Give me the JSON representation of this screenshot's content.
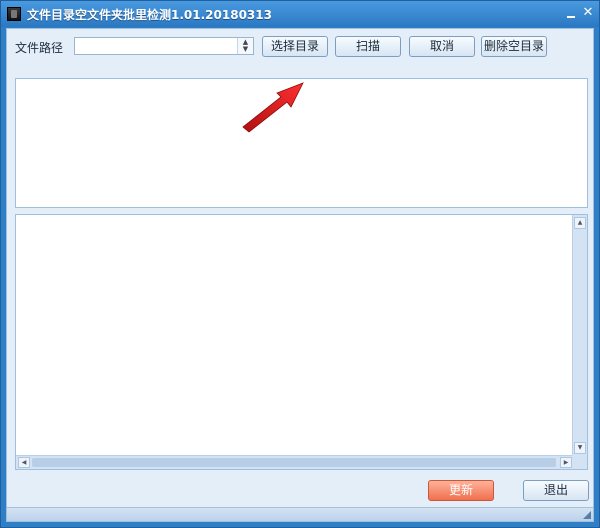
{
  "window": {
    "title": "文件目录空文件夹批里检测1.01.20180313",
    "minimize_glyph": "",
    "close_glyph": "✕"
  },
  "toolbar": {
    "path_label": "文件路径",
    "path_value": "",
    "path_placeholder": "",
    "select_dir_label": "选择目录",
    "scan_label": "扫描",
    "cancel_label": "取消",
    "delete_empty_label": "删除空目录"
  },
  "footer": {
    "refresh_label": "更新",
    "exit_label": "退出"
  },
  "colors": {
    "accent_frame": "#2f7fc7",
    "refresh_button": "#f06f4e",
    "annotation_arrow": "#e02020"
  },
  "icons": {
    "app": "app-icon",
    "minimize": "minimize-icon",
    "close": "close-icon",
    "combo": "updown-arrows-icon",
    "annotation": "red-arrow-icon"
  }
}
